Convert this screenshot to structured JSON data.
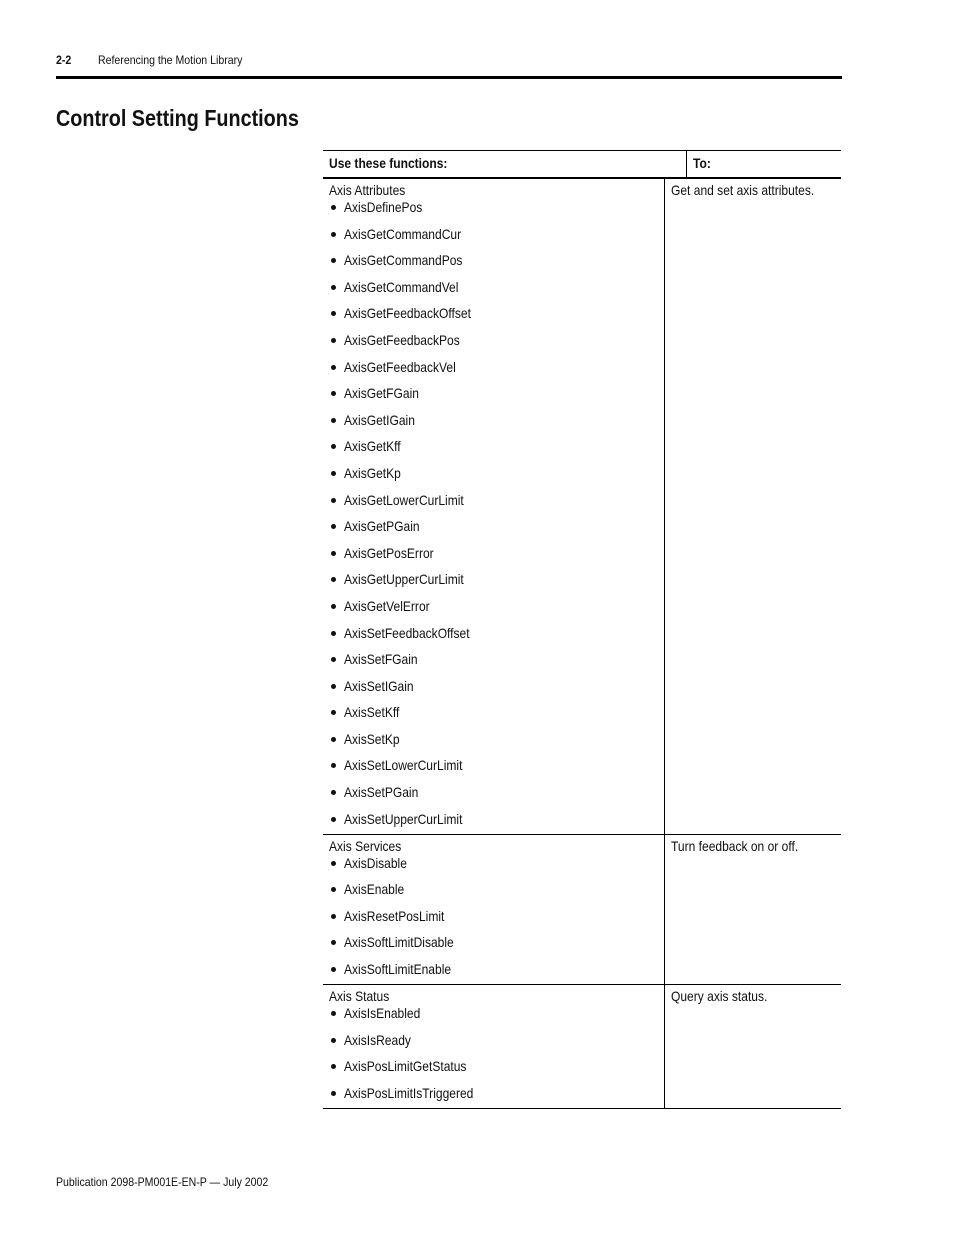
{
  "header": {
    "page_number": "2-2",
    "chapter_title": "Referencing the Motion Library"
  },
  "title": "Control Setting Functions",
  "table": {
    "headers": [
      "Use these functions:",
      "To:"
    ],
    "rows": [
      {
        "group": "Axis Attributes",
        "functions": [
          "AxisDefinePos",
          "AxisGetCommandCur",
          "AxisGetCommandPos",
          "AxisGetCommandVel",
          "AxisGetFeedbackOffset",
          "AxisGetFeedbackPos",
          "AxisGetFeedbackVel",
          "AxisGetFGain",
          "AxisGetIGain",
          "AxisGetKff",
          "AxisGetKp",
          "AxisGetLowerCurLimit",
          "AxisGetPGain",
          "AxisGetPosError",
          "AxisGetUpperCurLimit",
          "AxisGetVelError",
          "AxisSetFeedbackOffset",
          "AxisSetFGain",
          "AxisSetIGain",
          "AxisSetKff",
          "AxisSetKp",
          "AxisSetLowerCurLimit",
          "AxisSetPGain",
          "AxisSetUpperCurLimit"
        ],
        "description": "Get and set axis attributes."
      },
      {
        "group": "Axis Services",
        "functions": [
          "AxisDisable",
          "AxisEnable",
          "AxisResetPosLimit",
          "AxisSoftLimitDisable",
          "AxisSoftLimitEnable"
        ],
        "description": "Turn feedback on or off."
      },
      {
        "group": "Axis Status",
        "functions": [
          "AxisIsEnabled",
          "AxisIsReady",
          "AxisPosLimitGetStatus",
          "AxisPosLimitIsTriggered"
        ],
        "description": "Query axis status."
      }
    ]
  },
  "footer": {
    "publication": "Publication 2098-PM001E-EN-P — July 2002"
  }
}
